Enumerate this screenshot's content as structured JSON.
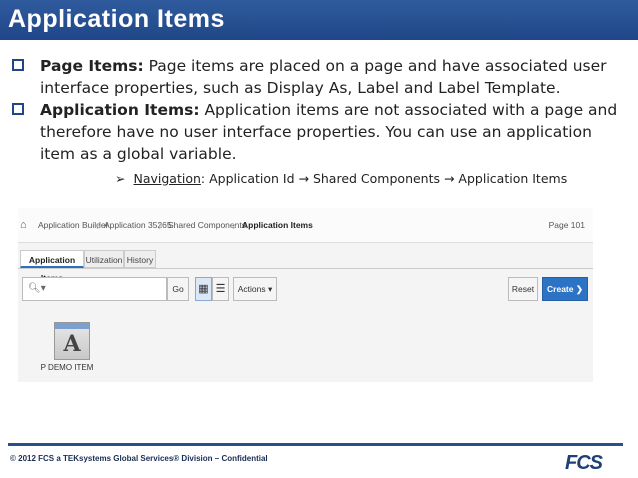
{
  "slide": {
    "title": "Application Items",
    "bullets": [
      {
        "term": "Page Items:",
        "text": " Page items are placed on a page and have associated user interface properties, such as Display As, Label and Label Template."
      },
      {
        "term": "Application Items:",
        "text": " Application items are not associated with a page and therefore have no user interface properties. You can use an application item as a global variable."
      }
    ],
    "navigation": {
      "label": "Navigation",
      "path": ": Application Id → Shared Components → Application Items"
    },
    "footer": "© 2012 FCS  a TEKsystems Global Services® Division – Confidential",
    "logo_text": "FCS"
  },
  "apex": {
    "breadcrumbs": [
      "Application Builder",
      "Application 35265",
      "Shared Components",
      "Application Items"
    ],
    "page_label": "Page 101",
    "tabs": [
      "Application Items",
      "Utilization",
      "History"
    ],
    "search": {
      "value": "",
      "icon": "search-icon"
    },
    "buttons": {
      "go": "Go",
      "actions": "Actions ▾",
      "reset": "Reset",
      "create": "Create ❯"
    },
    "items": [
      {
        "label": "P DEMO ITEM",
        "icon_letter": "A"
      }
    ]
  }
}
